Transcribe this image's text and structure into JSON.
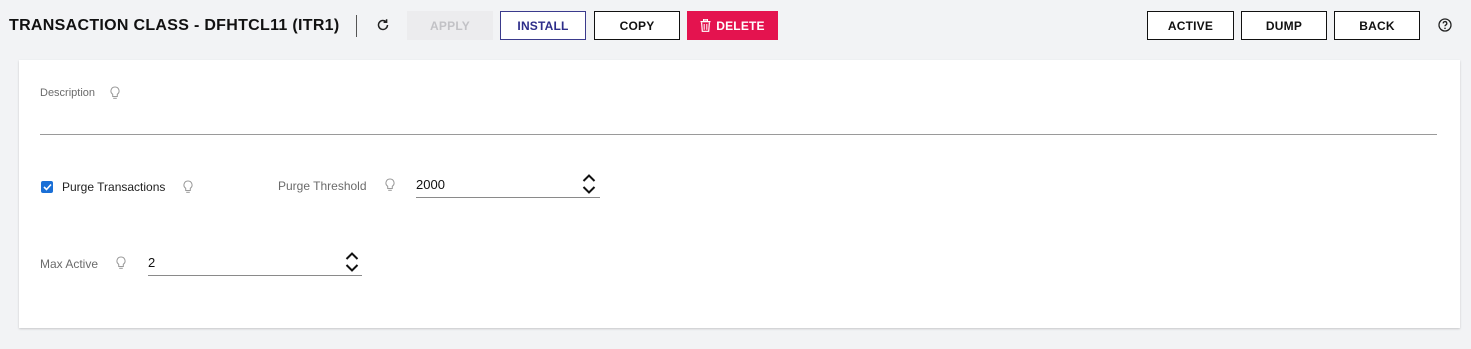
{
  "header": {
    "title": "TRANSACTION CLASS - DFHTCL11 (ITR1)",
    "buttons": {
      "apply": "APPLY",
      "install": "INSTALL",
      "copy": "COPY",
      "delete": "DELETE",
      "active": "ACTIVE",
      "dump": "DUMP",
      "back": "BACK"
    },
    "icons": {
      "refresh": "refresh-icon",
      "delete": "trash-icon",
      "help": "help-circle-icon"
    }
  },
  "form": {
    "description": {
      "label": "Description",
      "value": ""
    },
    "purge_transactions": {
      "label": "Purge Transactions",
      "checked": true
    },
    "purge_threshold": {
      "label": "Purge Threshold",
      "value": "2000"
    },
    "max_active": {
      "label": "Max Active",
      "value": "2"
    }
  },
  "colors": {
    "delete_bg": "#e4134f",
    "install_text": "#2d2d8a",
    "checkbox": "#1a6fd6",
    "apply_disabled_bg": "#ececee"
  }
}
